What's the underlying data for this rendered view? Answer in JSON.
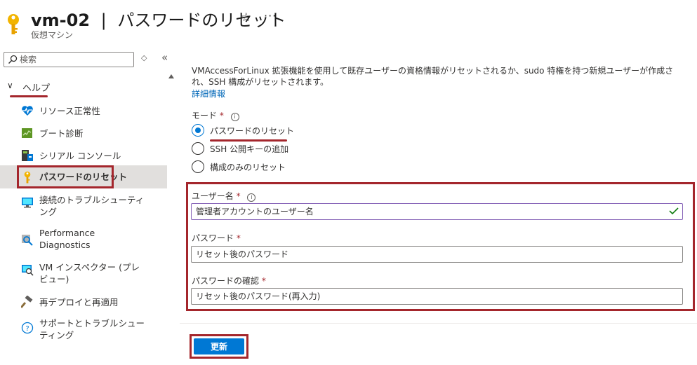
{
  "header": {
    "vm_name": "vm-02",
    "separator": "|",
    "page_title": "パスワードのリセット",
    "subtitle": "仮想マシン",
    "key_icon": "key-icon",
    "star_icon": "star-icon",
    "more_icon": "more-icon"
  },
  "sidebar": {
    "search_placeholder": "検索",
    "group_label": "ヘルプ",
    "items": [
      {
        "label": "リソース正常性",
        "icon": "heartbeat-icon"
      },
      {
        "label": "ブート診断",
        "icon": "boot-diagnostics-icon"
      },
      {
        "label": "シリアル コンソール",
        "icon": "serial-console-icon"
      },
      {
        "label": "パスワードのリセット",
        "icon": "key-icon",
        "active": true
      },
      {
        "label": "接続のトラブルシューティング",
        "icon": "monitor-icon"
      },
      {
        "label": "Performance Diagnostics",
        "icon": "performance-diagnostics-icon"
      },
      {
        "label": "VM インスペクター (プレビュー)",
        "icon": "vm-inspector-icon"
      },
      {
        "label": "再デプロイと再適用",
        "icon": "hammer-icon"
      },
      {
        "label": "サポートとトラブルシューティング",
        "icon": "help-icon"
      }
    ]
  },
  "main": {
    "description": "VMAccessForLinux 拡張機能を使用して既存ユーザーの資格情報がリセットされるか、sudo 特権を持つ新規ユーザーが作成され、SSH 構成がリセットされます。",
    "learn_more": "詳細情報",
    "mode_label": "モード",
    "mode_options": [
      "パスワードのリセット",
      "SSH 公開キーの追加",
      "構成のみのリセット"
    ],
    "selected_mode": "パスワードのリセット",
    "username_label": "ユーザー名",
    "username_placeholder": "管理者アカウントのユーザー名",
    "password_label": "パスワード",
    "password_placeholder": "リセット後のパスワード",
    "confirm_label": "パスワードの確認",
    "confirm_placeholder": "リセット後のパスワード(再入力)",
    "required_mark": "*",
    "update_button": "更新"
  },
  "colors": {
    "accent": "#0078d4",
    "highlight": "#a4262c",
    "active_bg": "#e1dfdd",
    "link": "#0067b8",
    "valid_check": "#107c10"
  }
}
